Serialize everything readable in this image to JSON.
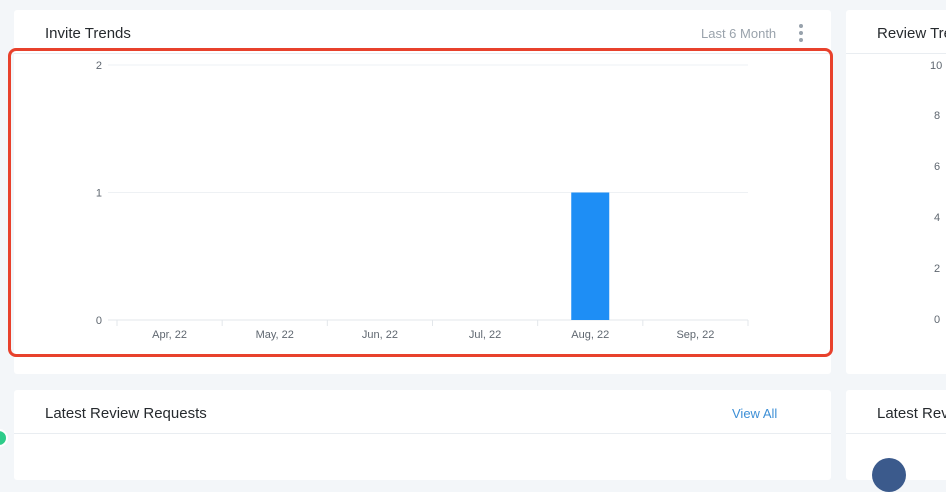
{
  "invite_trends": {
    "title": "Invite Trends",
    "range_label": "Last 6 Month"
  },
  "chart_data": {
    "type": "bar",
    "categories": [
      "Apr, 22",
      "May, 22",
      "Jun, 22",
      "Jul, 22",
      "Aug, 22",
      "Sep, 22"
    ],
    "values": [
      0,
      0,
      0,
      0,
      1,
      0
    ],
    "ylim": [
      0,
      2
    ],
    "yticks": [
      0,
      1,
      2
    ],
    "grid": true,
    "bar_color": "#1e8ef5"
  },
  "review_trends": {
    "title": "Review Tre",
    "y_ticks": [
      "10",
      "8",
      "6",
      "4",
      "2",
      "0"
    ]
  },
  "latest_review_requests": {
    "title": "Latest Review Requests",
    "view_all_label": "View All"
  },
  "latest_reviews": {
    "title": "Latest Rev"
  },
  "colors": {
    "highlight": "#e8412c",
    "link": "#3d8fd6",
    "status_dot": "#2ecc8a"
  }
}
